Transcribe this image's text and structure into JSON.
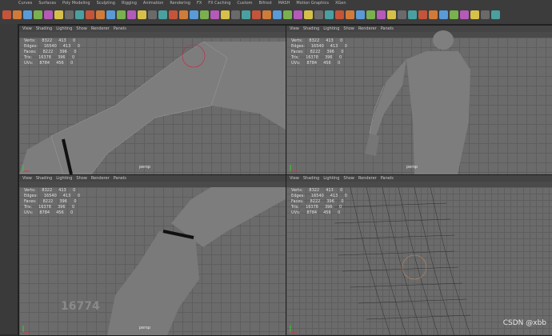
{
  "menu": {
    "tabs": [
      "Curves",
      "Surfaces",
      "Poly Modeling",
      "Sculpting",
      "Rigging",
      "Animation",
      "Rendering",
      "FX",
      "FX Caching",
      "Custom",
      "Bifrost",
      "MASH",
      "Motion Graphics",
      "XGen"
    ]
  },
  "viewports": [
    {
      "id": "top-left",
      "menu": [
        "View",
        "Shading",
        "Lighting",
        "Show",
        "Renderer",
        "Panels"
      ],
      "hud": {
        "rows": [
          [
            "Verts:",
            "8322",
            "413",
            "0"
          ],
          [
            "Edges:",
            "16540",
            "413",
            "0"
          ],
          [
            "Faces:",
            "8222",
            "396",
            "0"
          ],
          [
            "Tris:",
            "16378",
            "396",
            "0"
          ],
          [
            "UVs:",
            "8784",
            "456",
            "0"
          ]
        ]
      },
      "camera": "persp"
    },
    {
      "id": "top-right",
      "menu": [
        "View",
        "Shading",
        "Lighting",
        "Show",
        "Renderer",
        "Panels"
      ],
      "hud": {
        "rows": [
          [
            "Verts:",
            "8322",
            "413",
            "0"
          ],
          [
            "Edges:",
            "16540",
            "413",
            "0"
          ],
          [
            "Faces:",
            "8222",
            "396",
            "0"
          ],
          [
            "Tris:",
            "16378",
            "396",
            "0"
          ],
          [
            "UVs:",
            "8784",
            "456",
            "0"
          ]
        ]
      },
      "camera": "persp"
    },
    {
      "id": "bottom-left",
      "menu": [
        "View",
        "Shading",
        "Lighting",
        "Show",
        "Renderer",
        "Panels"
      ],
      "hud": {
        "rows": [
          [
            "Verts:",
            "8322",
            "413",
            "0"
          ],
          [
            "Edges:",
            "16540",
            "413",
            "0"
          ],
          [
            "Faces:",
            "8222",
            "396",
            "0"
          ],
          [
            "Tris:",
            "16378",
            "396",
            "0"
          ],
          [
            "UVs:",
            "8784",
            "456",
            "0"
          ]
        ]
      },
      "camera": "persp"
    },
    {
      "id": "bottom-right",
      "menu": [
        "View",
        "Shading",
        "Lighting",
        "Show",
        "Renderer",
        "Panels"
      ],
      "hud": {
        "rows": [
          [
            "Verts:",
            "8322",
            "413",
            "0"
          ],
          [
            "Edges:",
            "16540",
            "413",
            "0"
          ],
          [
            "Faces:",
            "8222",
            "396",
            "0"
          ],
          [
            "Tris:",
            "16378",
            "396",
            "0"
          ],
          [
            "UVs:",
            "8784",
            "456",
            "0"
          ]
        ]
      },
      "camera": "persp"
    }
  ],
  "watermark_number": "16774",
  "credit": "CSDN @xbb",
  "colors": {
    "bg": "#6b6b6b",
    "grid": "#5e5e5e",
    "toolbar": "#3c3c3c",
    "mesh": "#8e8e8e"
  }
}
